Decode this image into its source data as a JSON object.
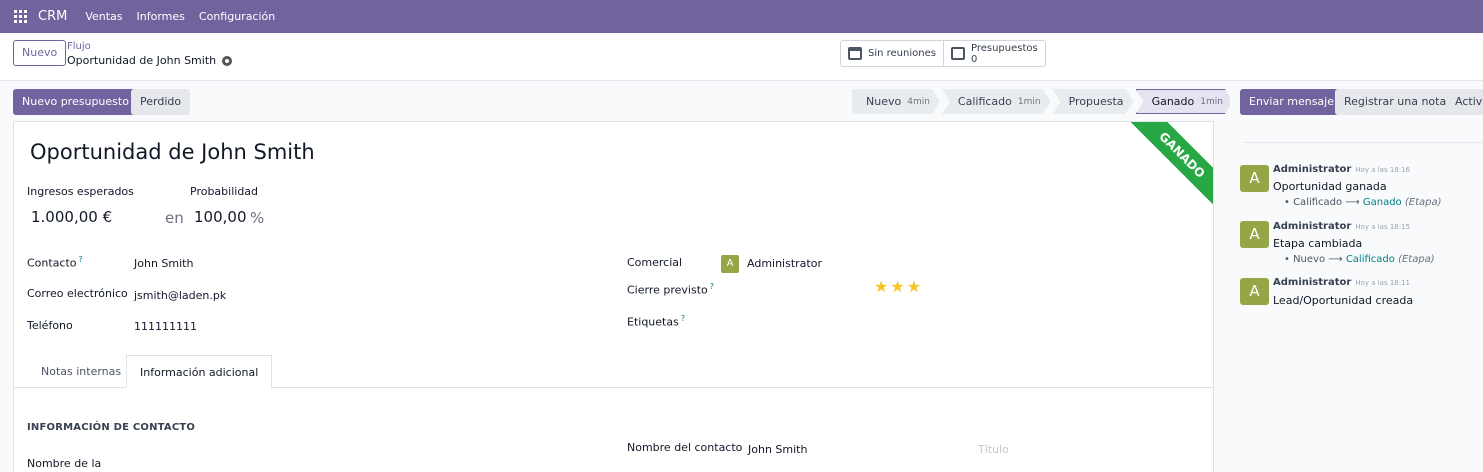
{
  "navbar": {
    "app": "CRM",
    "menu": [
      "Ventas",
      "Informes",
      "Configuración"
    ]
  },
  "control": {
    "new_label": "Nuevo",
    "breadcrumb_parent": "Flujo",
    "breadcrumb_current": "Oportunidad de John Smith",
    "meetings_label": "Sin reuniones",
    "quotes_label": "Presupuestos",
    "quotes_count": "0"
  },
  "actions": {
    "new_quote": "Nuevo presupuesto",
    "lost": "Perdido"
  },
  "stages": [
    {
      "name": "Nuevo",
      "duration": "4min"
    },
    {
      "name": "Calificado",
      "duration": "1min"
    },
    {
      "name": "Propuesta",
      "duration": ""
    },
    {
      "name": "Ganado",
      "duration": "1min"
    }
  ],
  "form": {
    "ribbon": "GANADO",
    "title": "Oportunidad de John Smith",
    "expected_revenue_label": "Ingresos esperados",
    "expected_revenue": "1.000,00 €",
    "probability_label": "Probabilidad",
    "probability_prefix": "en",
    "probability": "100,00",
    "probability_unit": "%",
    "contact_label": "Contacto",
    "contact": "John Smith",
    "email_label": "Correo electrónico",
    "email": "jsmith@laden.pk",
    "phone_label": "Teléfono",
    "phone": "111111111",
    "salesperson_label": "Comercial",
    "salesperson_initial": "A",
    "salesperson": "Administrator",
    "closing_label": "Cierre previsto",
    "tags_label": "Etiquetas",
    "help_mark": "?",
    "priority_stars": 3,
    "tabs": [
      "Notas internas",
      "Información adicional"
    ],
    "section_contact": "INFORMACIÓN DE CONTACTO",
    "company_name_label": "Nombre de la",
    "contact_name_label": "Nombre del contacto",
    "contact_name": "John Smith",
    "title_placeholder": "Título"
  },
  "chatter": {
    "send_message": "Enviar mensaje",
    "log_note": "Registrar una nota",
    "activities": "Activi",
    "messages": [
      {
        "initial": "A",
        "author": "Administrator",
        "time": "Hoy a las 18:16",
        "body": "Oportunidad ganada",
        "from": "Calificado",
        "arrow": "⟶",
        "to": "Ganado",
        "field": "(Etapa)"
      },
      {
        "initial": "A",
        "author": "Administrator",
        "time": "Hoy a las 18:15",
        "body": "Etapa cambiada",
        "from": "Nuevo",
        "arrow": "⟶",
        "to": "Calificado",
        "field": "(Etapa)"
      },
      {
        "initial": "A",
        "author": "Administrator",
        "time": "Hoy a las 18:11",
        "body": "Lead/Oportunidad creada"
      }
    ]
  },
  "colors": {
    "brand": "#71639e",
    "won": "#28a745",
    "avatar": "#96a646",
    "star": "#f3c623"
  }
}
